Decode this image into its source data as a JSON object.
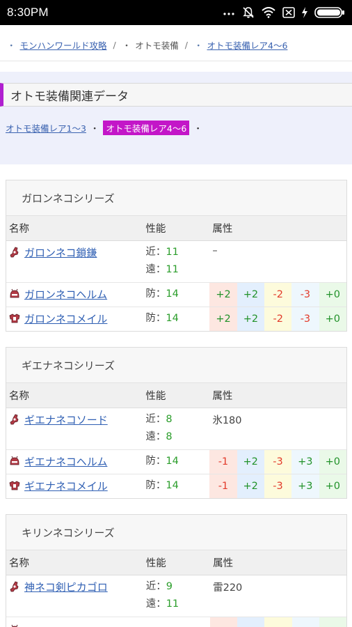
{
  "status": {
    "time": "8:30PM"
  },
  "breadcrumb": [
    {
      "label": "モンハンワールド攻略",
      "link": true
    },
    {
      "label": "オトモ装備",
      "link": false
    },
    {
      "label": "オトモ装備レア4〜6",
      "link": true
    }
  ],
  "related": {
    "heading": "オトモ装備関連データ",
    "links": [
      {
        "label": "オトモ装備レア1〜3",
        "active": false
      },
      {
        "label": "オトモ装備レア4〜6",
        "active": true
      }
    ]
  },
  "table_headers": {
    "name": "名称",
    "perf": "性能",
    "attr": "属性"
  },
  "perf_labels": {
    "near": "近：",
    "far": "遠：",
    "def": "防："
  },
  "series": [
    {
      "title": "ガロンネコシリーズ",
      "weapon": {
        "name": "ガロンネコ鎖鎌",
        "near": "11",
        "far": "11",
        "attr": "–"
      },
      "armors": [
        {
          "name": "ガロンネコヘルム",
          "icon": "helm-icon",
          "def": "14",
          "res": [
            "+2",
            "+2",
            "-2",
            "-3",
            "+0"
          ]
        },
        {
          "name": "ガロンネコメイル",
          "icon": "mail-icon",
          "def": "14",
          "res": [
            "+2",
            "+2",
            "-2",
            "-3",
            "+0"
          ]
        }
      ]
    },
    {
      "title": "ギエナネコシリーズ",
      "weapon": {
        "name": "ギエナネコソード",
        "near": "8",
        "far": "8",
        "attr": "氷180"
      },
      "armors": [
        {
          "name": "ギエナネコヘルム",
          "icon": "helm-icon",
          "def": "14",
          "res": [
            "-1",
            "+2",
            "-3",
            "+3",
            "+0"
          ]
        },
        {
          "name": "ギエナネコメイル",
          "icon": "mail-icon",
          "def": "14",
          "res": [
            "-1",
            "+2",
            "-3",
            "+3",
            "+0"
          ]
        }
      ]
    },
    {
      "title": "キリンネコシリーズ",
      "weapon": {
        "name": "神ネコ剣ピカゴロ",
        "near": "9",
        "far": "11",
        "attr": "雷220"
      },
      "armors": []
    }
  ]
}
